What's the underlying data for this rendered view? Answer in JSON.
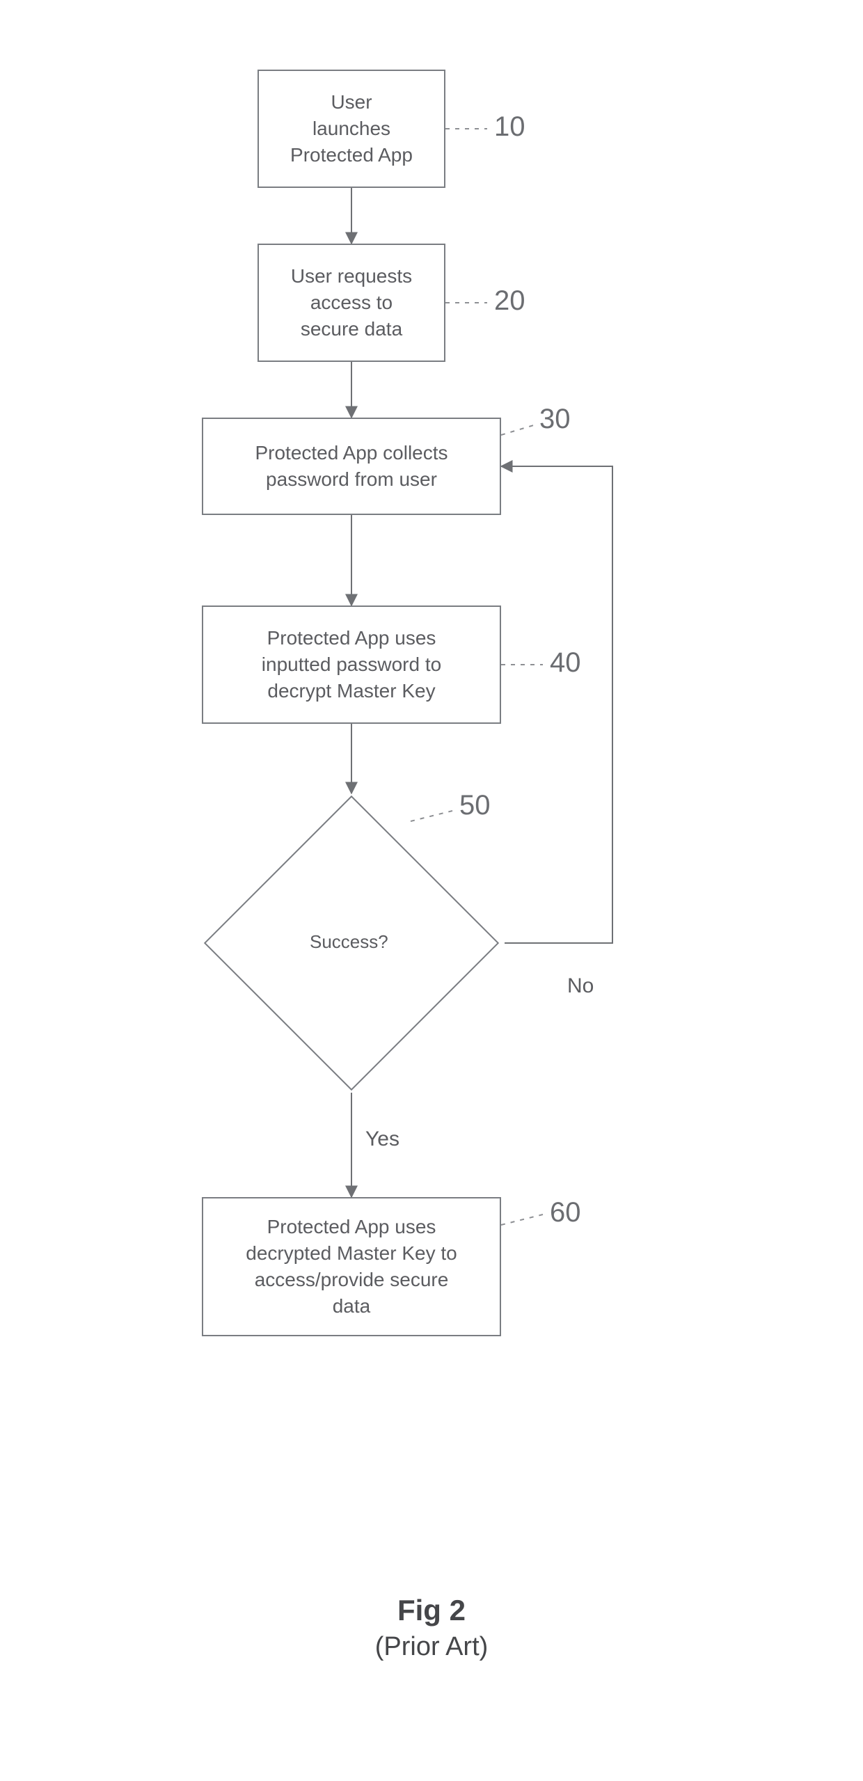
{
  "nodes": {
    "n10": {
      "text": "User\nlaunches\nProtected App",
      "ref": "10"
    },
    "n20": {
      "text": "User requests\naccess to\nsecure data",
      "ref": "20"
    },
    "n30": {
      "text": "Protected App collects\npassword from user",
      "ref": "30"
    },
    "n40": {
      "text": "Protected App uses\ninputted password to\ndecrypt Master Key",
      "ref": "40"
    },
    "d50": {
      "text": "Success?",
      "ref": "50"
    },
    "n60": {
      "text": "Protected App uses\ndecrypted Master Key to\naccess/provide secure\ndata",
      "ref": "60"
    }
  },
  "edges": {
    "yes": "Yes",
    "no": "No"
  },
  "caption": {
    "title": "Fig 2",
    "subtitle": "(Prior Art)"
  }
}
